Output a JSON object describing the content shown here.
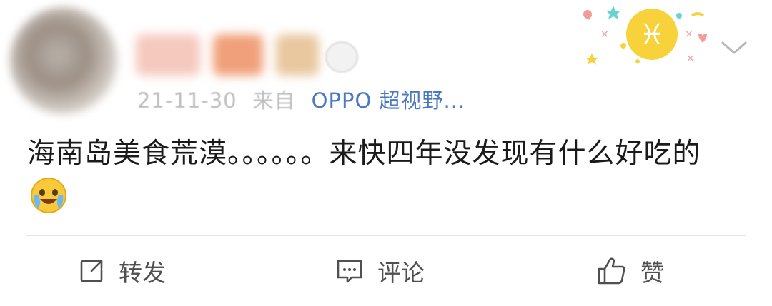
{
  "post": {
    "meta": {
      "date": "21-11-30",
      "from_label": "来自",
      "device": "OPPO 超视野..."
    },
    "content_text": "海南岛美食荒漠。。。。。。来快四年没发现有什么好吃的",
    "emoji_icon": "laugh-cry-emoji-icon"
  },
  "badge": {
    "icon": "pisces-zodiac-badge-icon",
    "glyph": "♓",
    "colors": {
      "star_yellow": "#f7d23a",
      "heart_pink": "#f39a9a",
      "sparkle_teal": "#69d3d0"
    }
  },
  "actions": {
    "repost_label": "转发",
    "comment_label": "评论",
    "like_label": "赞"
  },
  "colors": {
    "text": "#1a1a1a",
    "link": "#4b78c2",
    "muted": "#bdbdbd",
    "action": "#505050"
  }
}
